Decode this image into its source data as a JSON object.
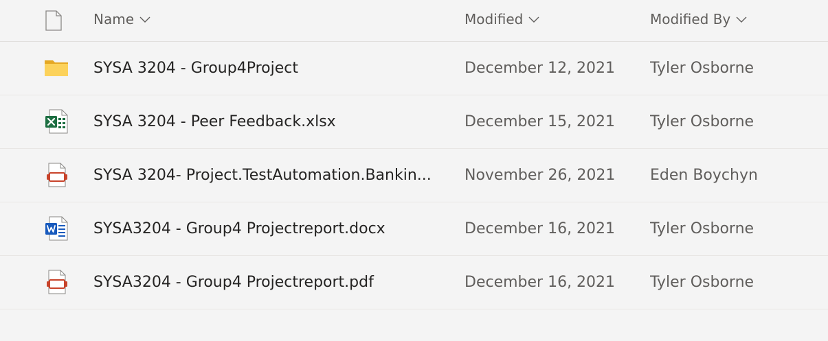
{
  "header": {
    "name_label": "Name",
    "modified_label": "Modified",
    "modified_by_label": "Modified By"
  },
  "files": [
    {
      "name": "SYSA 3204 - Group4Project",
      "modified": "December 12, 2021",
      "modified_by": "Tyler Osborne",
      "icon": "folder-icon"
    },
    {
      "name": "SYSA 3204 - Peer Feedback.xlsx",
      "modified": "December 15, 2021",
      "modified_by": "Tyler Osborne",
      "icon": "excel-file-icon"
    },
    {
      "name": "SYSA 3204- Project.TestAutomation.Bankin...",
      "modified": "November 26, 2021",
      "modified_by": "Eden Boychyn",
      "icon": "pdf-file-icon"
    },
    {
      "name": "SYSA3204 - Group4 Projectreport.docx",
      "modified": "December 16, 2021",
      "modified_by": "Tyler Osborne",
      "icon": "word-file-icon"
    },
    {
      "name": "SYSA3204 - Group4 Projectreport.pdf",
      "modified": "December 16, 2021",
      "modified_by": "Tyler Osborne",
      "icon": "pdf-file-icon"
    }
  ],
  "colors": {
    "background": "#f4f4f4",
    "folder": "#f8c43f",
    "excel": "#1d6f42",
    "word": "#185abd",
    "pdf": "#c8432a"
  }
}
